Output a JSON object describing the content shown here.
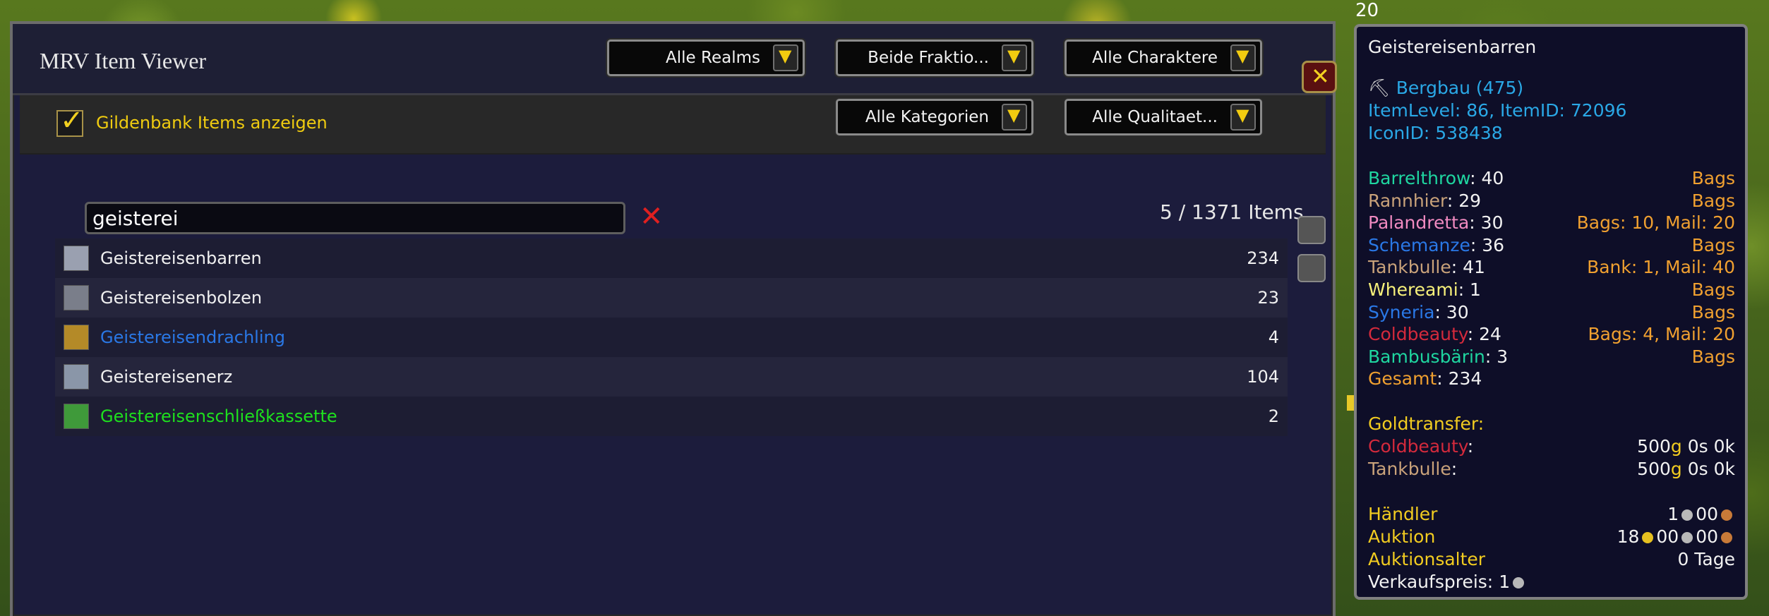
{
  "window": {
    "title": "MRV Item Viewer",
    "realm_dropdown": "Alle Realms",
    "faction_dropdown": "Beide Fraktio...",
    "character_dropdown": "Alle Charaktere",
    "category_dropdown": "Alle Kategorien",
    "quality_dropdown": "Alle Qualitaet...",
    "guildbank_label": "Gildenbank Items anzeigen",
    "guildbank_checked": true,
    "close_icon": "close-icon"
  },
  "search": {
    "value": "geisterei",
    "count": "5 / 1371 Items"
  },
  "items": [
    {
      "name": "Geistereisenbarren",
      "qty": "234",
      "quality": "common",
      "icon": "bar-icon"
    },
    {
      "name": "Geistereisenbolzen",
      "qty": "23",
      "quality": "common",
      "icon": "bolt-icon"
    },
    {
      "name": "Geistereisendrachling",
      "qty": "4",
      "quality": "rare",
      "icon": "dragonling-icon"
    },
    {
      "name": "Geistereisenerz",
      "qty": "104",
      "quality": "common",
      "icon": "ore-icon"
    },
    {
      "name": "Geistereisenschließkassette",
      "qty": "2",
      "quality": "uncommon",
      "icon": "lockbox-icon"
    }
  ],
  "tooltip": {
    "stack": "20",
    "title": "Geistereisenbarren",
    "profession": "Bergbau (475)",
    "itemlevel": "ItemLevel: 86, ItemID: 72096",
    "iconid": "IconID: 538438",
    "characters": [
      {
        "name": "Barrelthrow",
        "count": ": 40",
        "loc": "Bags",
        "color": "#1fd6a0"
      },
      {
        "name": "Rannhier",
        "count": ": 29",
        "loc": "Bags",
        "color": "#c9a27a"
      },
      {
        "name": "Palandretta",
        "count": ": 30",
        "loc": "Bags: 10, Mail: 20",
        "color": "#f08ac0"
      },
      {
        "name": "Schemanze",
        "count": ": 36",
        "loc": "Bags",
        "color": "#2a78e6"
      },
      {
        "name": "Tankbulle",
        "count": ": 41",
        "loc": "Bank: 1, Mail: 40",
        "color": "#c9a27a"
      },
      {
        "name": "Whereami",
        "count": ": 1",
        "loc": "Bags",
        "color": "#f6f07a"
      },
      {
        "name": "Syneria",
        "count": ": 30",
        "loc": "Bags",
        "color": "#2a78e6"
      },
      {
        "name": "Coldbeauty",
        "count": ": 24",
        "loc": "Bags: 4, Mail: 20",
        "color": "#d42a3c"
      },
      {
        "name": "Bambusbärin",
        "count": ": 3",
        "loc": "Bags",
        "color": "#1fd6a0"
      }
    ],
    "total_label": "Gesamt",
    "total_value": ": 234",
    "goldtransfer_label": "Goldtransfer:",
    "gold_rows": [
      {
        "name": "Coldbeauty",
        "value": "500",
        "color": "#d42a3c"
      },
      {
        "name": "Tankbulle",
        "value": "500",
        "color": "#c9a27a"
      }
    ],
    "gold_suffix_g": "g",
    "gold_suffix_s": " 0s",
    "gold_suffix_k": " 0k",
    "vendor_label": "Händler",
    "vendor_value_a": "1",
    "vendor_value_b": "00",
    "auction_label": "Auktion",
    "auction_value_a": "18",
    "auction_value_b": "00",
    "auction_value_c": "00",
    "auction_age_label": "Auktionsalter",
    "auction_age_value": "0 Tage",
    "sell_label": "Verkaufspreis:",
    "sell_value": "1"
  }
}
